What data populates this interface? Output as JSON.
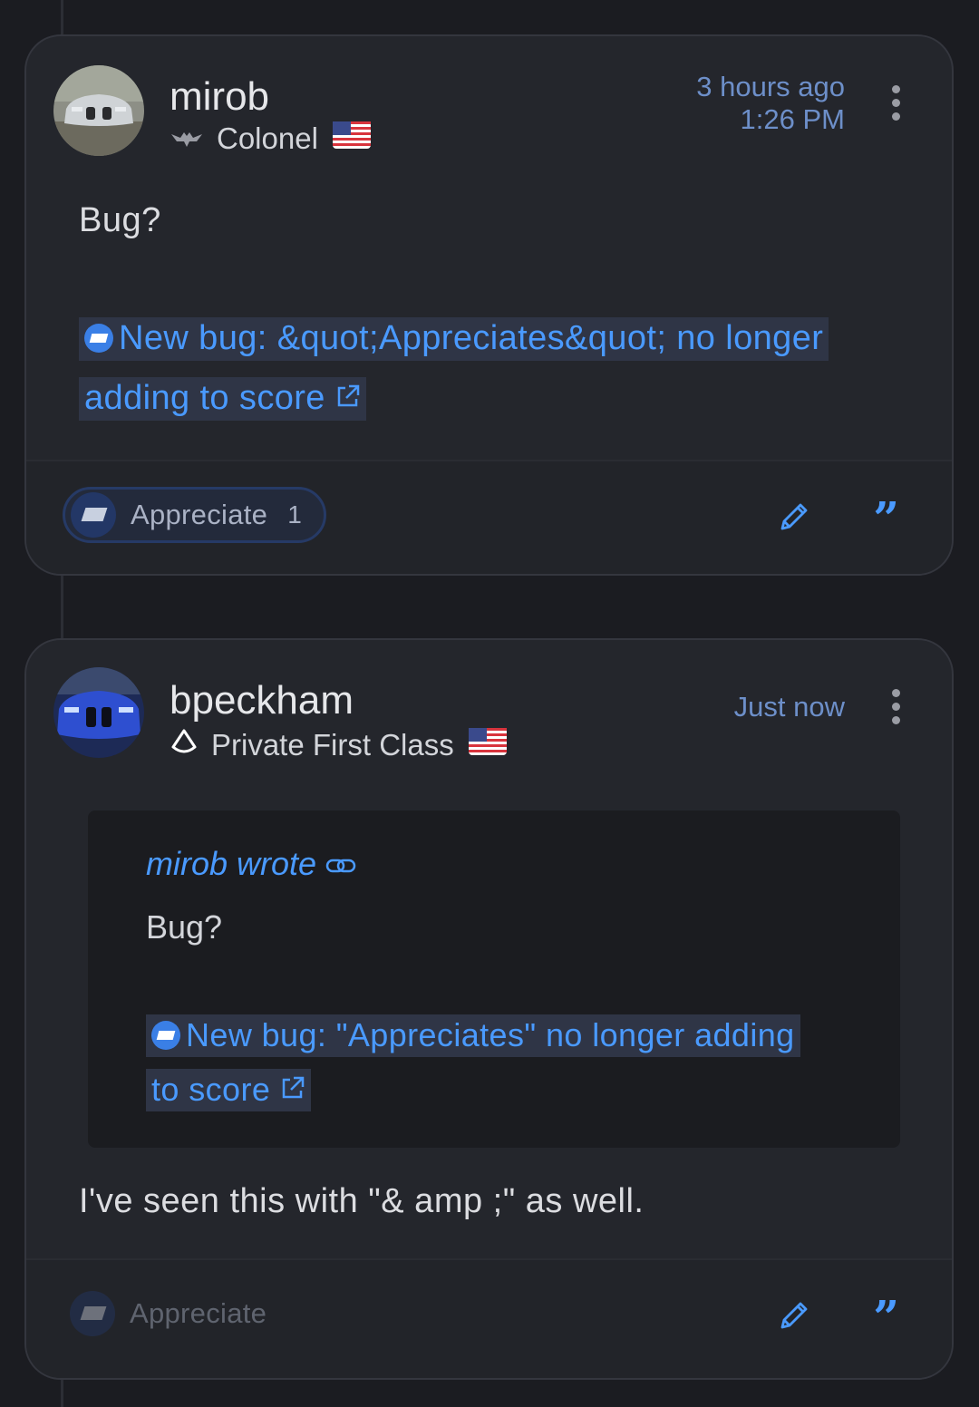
{
  "posts": [
    {
      "username": "mirob",
      "rank": "Colonel",
      "time_relative": "3 hours ago",
      "time_absolute": "1:26 PM",
      "body": "Bug?",
      "link_line1": "New bug: &quot;Appreciates&quot; no longer",
      "link_line2": "adding to score",
      "appreciate_label": "Appreciate",
      "appreciate_count": "1"
    },
    {
      "username": "bpeckham",
      "rank": "Private First Class",
      "time_relative": "Just now",
      "quote": {
        "author": "mirob wrote",
        "body": "Bug?",
        "link_line1": "New bug: \"Appreciates\" no longer adding",
        "link_line2": "to score"
      },
      "body": "I've seen this with \"& amp ;\" as well.",
      "appreciate_label": "Appreciate"
    }
  ],
  "icons": {
    "menu": "kebab-menu-icon",
    "edit": "pencil-icon",
    "quote": "quote-icon",
    "external": "external-link-icon",
    "chain": "link-chain-icon",
    "flag": "us-flag-icon"
  },
  "colors": {
    "accent": "#4a9aff",
    "background": "#1b1c21",
    "card": "#24262c"
  }
}
